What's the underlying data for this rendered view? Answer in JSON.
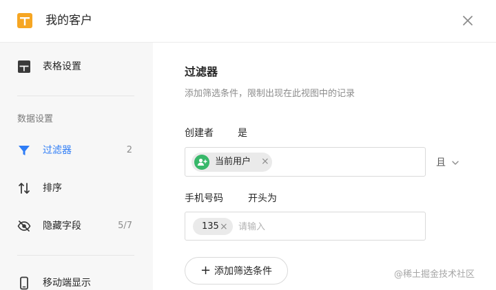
{
  "header": {
    "title": "我的客户",
    "app_icon": "table-icon",
    "close_icon": "close-icon"
  },
  "sidebar": {
    "table_settings": {
      "label": "表格设置",
      "icon": "grid-icon"
    },
    "section_label": "数据设置",
    "items": [
      {
        "label": "过滤器",
        "count": "2",
        "icon": "filter-icon",
        "active": true
      },
      {
        "label": "排序",
        "count": "",
        "icon": "sort-icon",
        "active": false
      },
      {
        "label": "隐藏字段",
        "count": "5/7",
        "icon": "eye-off-icon",
        "active": false
      },
      {
        "label": "移动端显示",
        "count": "",
        "icon": "mobile-icon",
        "active": false
      }
    ]
  },
  "main": {
    "title": "过滤器",
    "description": "添加筛选条件，限制出现在此视图中的记录",
    "conditions": [
      {
        "field": "创建者",
        "operator": "是",
        "chip_label": "当前用户",
        "chip_icon": "user-avatar-icon"
      },
      {
        "field": "手机号码",
        "operator": "开头为",
        "chip_label": "135",
        "input_placeholder": "请输入"
      }
    ],
    "logic": "且",
    "add_button": "添加筛选条件"
  },
  "watermark": "@稀土掘金技术社区",
  "colors": {
    "accent": "#2f7df6",
    "app_icon": "#f6a623",
    "avatar": "#38b86a",
    "sidebar_bg": "#f7f7f7"
  }
}
